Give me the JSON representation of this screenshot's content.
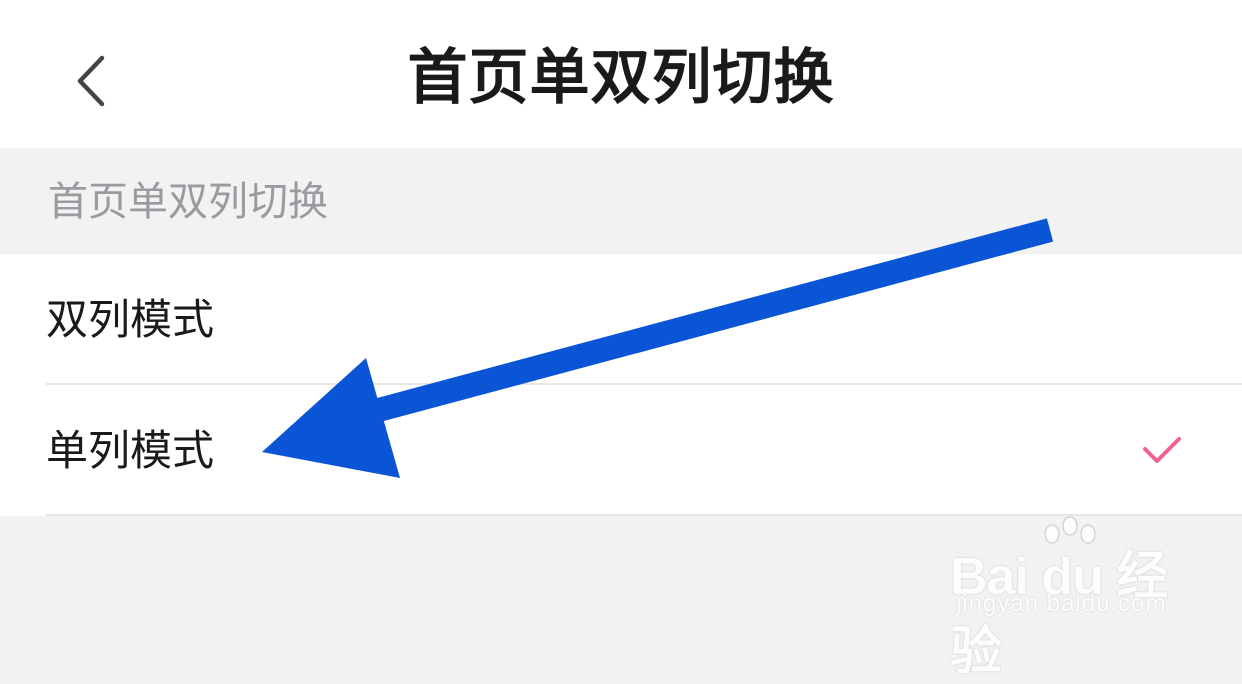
{
  "header": {
    "title": "首页单双列切换",
    "back_icon": "chevron-left-icon"
  },
  "section": {
    "title": "首页单双列切换"
  },
  "options": [
    {
      "label": "双列模式",
      "selected": false
    },
    {
      "label": "单列模式",
      "selected": true
    }
  ],
  "colors": {
    "check": "#f06292",
    "arrow": "#0a55d6"
  },
  "watermark": {
    "brand": "Bai du 经验",
    "url": "jingyan.baidu.com"
  }
}
